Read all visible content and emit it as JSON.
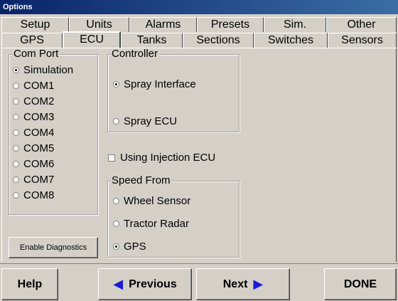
{
  "window": {
    "title": "Options"
  },
  "tabs_back": [
    {
      "label": "Setup"
    },
    {
      "label": "Units"
    },
    {
      "label": "Alarms"
    },
    {
      "label": "Presets"
    },
    {
      "label": "Sim."
    },
    {
      "label": "Other"
    }
  ],
  "tabs_front": [
    {
      "label": "GPS"
    },
    {
      "label": "ECU",
      "active": true
    },
    {
      "label": "Tanks"
    },
    {
      "label": "Sections"
    },
    {
      "label": "Switches"
    },
    {
      "label": "Sensors"
    }
  ],
  "com_port": {
    "title": "Com Port",
    "selected": "Simulation",
    "options": [
      "Simulation",
      "COM1",
      "COM2",
      "COM3",
      "COM4",
      "COM5",
      "COM6",
      "COM7",
      "COM8"
    ]
  },
  "controller": {
    "title": "Controller",
    "selected": "Spray Interface",
    "options": [
      "Spray Interface",
      "Spray ECU"
    ]
  },
  "injection": {
    "label": "Using Injection ECU",
    "checked": false
  },
  "speed_from": {
    "title": "Speed From",
    "selected": "GPS",
    "options": [
      "Wheel Sensor",
      "Tractor Radar",
      "GPS"
    ]
  },
  "diagnostics_button": {
    "label": "Enable Diagnostics"
  },
  "footer": {
    "help": "Help",
    "previous": "Previous",
    "next": "Next",
    "done": "DONE",
    "arrow_left": "◀",
    "arrow_right": "▶"
  }
}
